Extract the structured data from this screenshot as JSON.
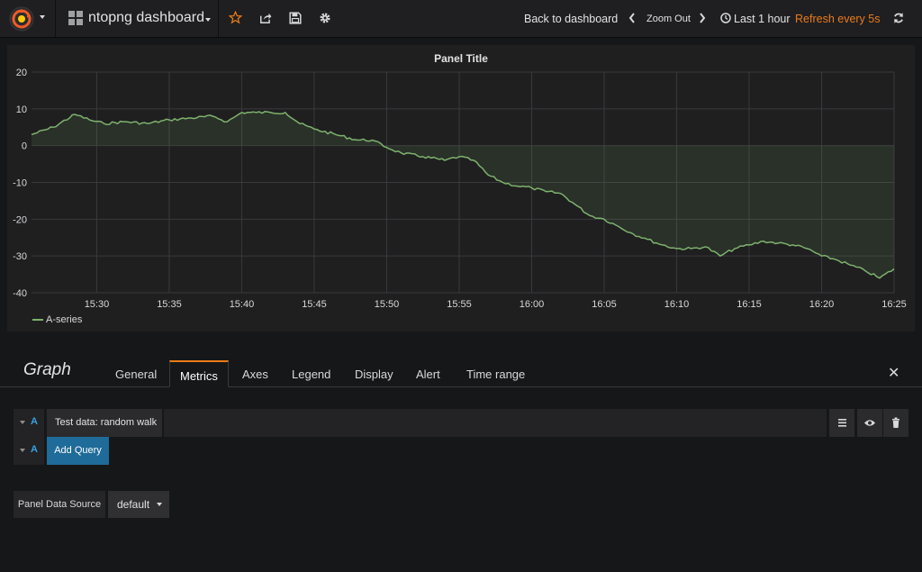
{
  "navbar": {
    "dashboard_title": "ntopng dashboard",
    "back_to_dashboard": "Back to dashboard",
    "zoom_out": "Zoom Out",
    "time_range": "Last 1 hour",
    "refresh": "Refresh every 5s"
  },
  "panel": {
    "title": "Panel Title",
    "legend": "A-series"
  },
  "chart_data": {
    "type": "area",
    "title": "Panel Title",
    "x_ticks": [
      "15:30",
      "15:35",
      "15:40",
      "15:45",
      "15:50",
      "15:55",
      "16:00",
      "16:05",
      "16:10",
      "16:15",
      "16:20",
      "16:25"
    ],
    "y_ticks": [
      20,
      10,
      0,
      -10,
      -20,
      -30,
      -40
    ],
    "ylim": [
      -40,
      20
    ],
    "xlim": [
      "15:25:30",
      "16:25:00"
    ],
    "grid": true,
    "legend_position": "bottom-left",
    "series": [
      {
        "name": "A-series",
        "color": "#7eb26d",
        "x": [
          "15:25:30",
          "15:27:00",
          "15:28:30",
          "15:29:30",
          "15:30:30",
          "15:32:00",
          "15:33:30",
          "15:35:00",
          "15:36:30",
          "15:38:00",
          "15:39:00",
          "15:40:00",
          "15:41:00",
          "15:42:00",
          "15:43:00",
          "15:44:00",
          "15:45:00",
          "15:46:30",
          "15:48:00",
          "15:49:00",
          "15:50:00",
          "15:51:00",
          "15:52:30",
          "15:54:00",
          "15:55:00",
          "15:56:00",
          "15:57:00",
          "15:58:00",
          "15:59:00",
          "16:00:00",
          "16:01:00",
          "16:02:00",
          "16:03:00",
          "16:04:00",
          "16:05:00",
          "16:06:00",
          "16:07:00",
          "16:08:00",
          "16:09:00",
          "16:10:00",
          "16:11:00",
          "16:12:00",
          "16:13:00",
          "16:14:00",
          "16:15:00",
          "16:16:00",
          "16:17:00",
          "16:18:00",
          "16:19:00",
          "16:20:00",
          "16:21:00",
          "16:22:00",
          "16:23:00",
          "16:24:00",
          "16:25:00"
        ],
        "y": [
          3,
          5,
          8.5,
          7,
          6,
          6.5,
          6,
          7,
          7.5,
          8,
          6.5,
          9,
          9,
          9,
          9,
          6,
          4.5,
          3,
          1.5,
          1.5,
          -0.5,
          -2,
          -3,
          -4,
          -3,
          -4,
          -8,
          -10,
          -11,
          -11.5,
          -12.5,
          -13,
          -16,
          -19,
          -20,
          -22,
          -24,
          -25.5,
          -27,
          -28,
          -28,
          -27.5,
          -30,
          -28,
          -27,
          -26,
          -26.5,
          -27,
          -28,
          -30,
          -31,
          -32.5,
          -34,
          -36,
          -33.5
        ]
      }
    ]
  },
  "editor": {
    "title": "Graph",
    "tabs": [
      "General",
      "Metrics",
      "Axes",
      "Legend",
      "Display",
      "Alert",
      "Time range"
    ],
    "active_tab": "Metrics",
    "query_letter": "A",
    "query_name": "Test data: random walk",
    "add_query_letter": "A",
    "add_query_label": "Add Query",
    "data_source_label": "Panel Data Source",
    "data_source_value": "default"
  },
  "colors": {
    "accent": "#eb7b18",
    "series": "#7eb26d",
    "query_letter": "#33a2e5",
    "add_query_bg": "#1f6b99"
  }
}
